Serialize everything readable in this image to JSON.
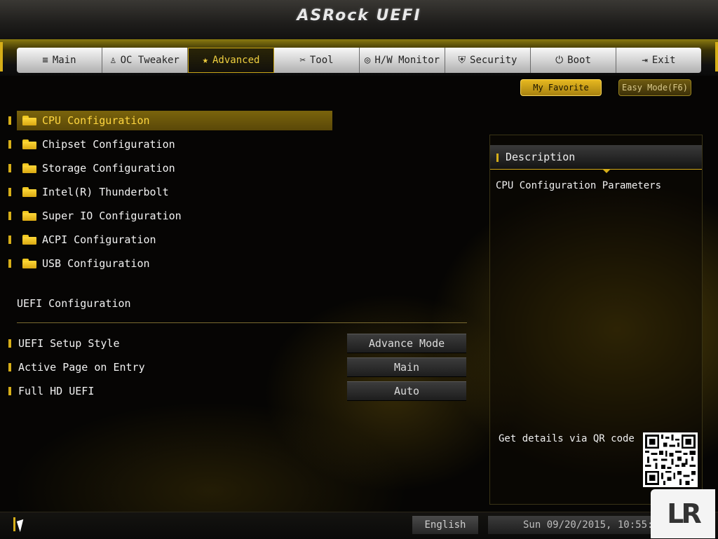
{
  "header": {
    "title": "ASRock UEFI"
  },
  "nav": {
    "tabs": [
      {
        "label": "Main",
        "icon": "≡",
        "active": false
      },
      {
        "label": "OC Tweaker",
        "icon": "♙",
        "active": false
      },
      {
        "label": "Advanced",
        "icon": "★",
        "active": true
      },
      {
        "label": "Tool",
        "icon": "✂",
        "active": false
      },
      {
        "label": "H/W Monitor",
        "icon": "◎",
        "active": false
      },
      {
        "label": "Security",
        "icon": "⛨",
        "active": false
      },
      {
        "label": "Boot",
        "icon": "⏻",
        "active": false
      },
      {
        "label": "Exit",
        "icon": "⇥",
        "active": false
      }
    ]
  },
  "toolbar": {
    "favorite_label": "My Favorite",
    "easy_mode_label": "Easy Mode(F6)"
  },
  "menu": {
    "items": [
      {
        "label": "CPU Configuration",
        "selected": true
      },
      {
        "label": "Chipset Configuration",
        "selected": false
      },
      {
        "label": "Storage Configuration",
        "selected": false
      },
      {
        "label": "Intel(R) Thunderbolt",
        "selected": false
      },
      {
        "label": "Super IO Configuration",
        "selected": false
      },
      {
        "label": "ACPI Configuration",
        "selected": false
      },
      {
        "label": "USB Configuration",
        "selected": false
      }
    ]
  },
  "uefi_config": {
    "title": "UEFI Configuration",
    "options": [
      {
        "label": "UEFI Setup Style",
        "value": "Advance Mode"
      },
      {
        "label": "Active Page on Entry",
        "value": "Main"
      },
      {
        "label": "Full HD UEFI",
        "value": "Auto"
      }
    ]
  },
  "description": {
    "title": "Description",
    "text": "CPU Configuration Parameters",
    "qr_label": "Get details via QR code"
  },
  "footer": {
    "language": "English",
    "datetime": "Sun 09/20/2015, 10:55:0"
  },
  "watermark": "LR",
  "colors": {
    "accent": "#d6ae18",
    "selected_bg": "#6e5a0c"
  }
}
